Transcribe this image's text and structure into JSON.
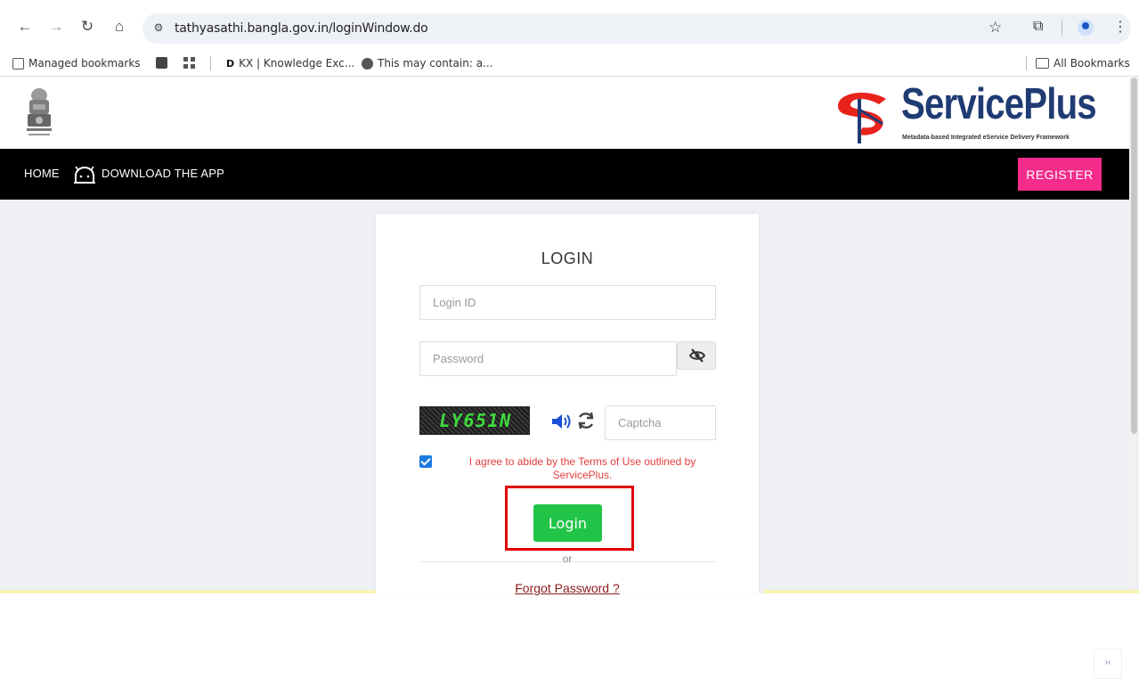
{
  "browser": {
    "url": "tathyasathi.bangla.gov.in/loginWindow.do",
    "bookmarks": [
      {
        "label": "Managed bookmarks"
      },
      {
        "label": ""
      },
      {
        "label": ""
      },
      {
        "label": "KX | Knowledge Exc..."
      },
      {
        "label": "This may contain: a..."
      }
    ],
    "all_bookmarks": "All Bookmarks"
  },
  "header": {
    "brand_name": "ServicePlus",
    "tagline": "Metadata-based Integrated eService Delivery Framework",
    "brand_color": "#1f3b73"
  },
  "navbar": {
    "home": "HOME",
    "download": "DOWNLOAD THE APP",
    "register": "REGISTER",
    "register_color": "#f32c8b"
  },
  "login": {
    "title": "LOGIN",
    "login_id_placeholder": "Login ID",
    "password_placeholder": "Password",
    "captcha_code": "LY651N",
    "captcha_placeholder": "Captcha",
    "agree_checked": true,
    "agree_text": "I agree to abide by the Terms of Use outlined by ServicePlus.",
    "login_button": "Login",
    "or": "or",
    "forgot_password": "Forgot Password ?",
    "login_color": "#22c447"
  },
  "side_widget": {
    "label": "›‹"
  }
}
